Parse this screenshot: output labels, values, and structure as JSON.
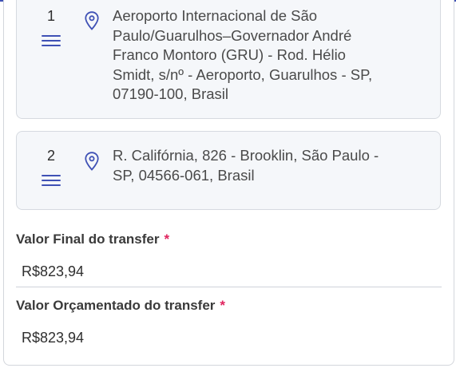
{
  "stops": [
    {
      "number": "1",
      "address_lines": [
        "Aeroporto Internacional de São",
        "Paulo/Guarulhos–Governador André",
        "Franco Montoro (GRU) - Rod. Hélio",
        "Smidt, s/nº - Aeroporto, Guarulhos - SP,",
        "07190-100, Brasil"
      ],
      "icons": [
        "drag-handle-icon",
        "map-pin-icon"
      ]
    },
    {
      "number": "2",
      "address_lines": [
        "R. Califórnia, 826 - Brooklin, São Paulo -",
        "SP, 04566-061, Brasil"
      ],
      "icons": [
        "drag-handle-icon",
        "map-pin-icon"
      ]
    }
  ],
  "fields": {
    "valor_final": {
      "label": "Valor Final do transfer",
      "required_mark": "*",
      "value": "R$823,94"
    },
    "valor_orcamentado": {
      "label": "Valor Orçamentado do transfer",
      "required_mark": "*",
      "value": "R$823,94"
    }
  },
  "colors": {
    "accent": "#3f51b5",
    "required": "#e0245e",
    "card_background": "#f5f7fa"
  }
}
